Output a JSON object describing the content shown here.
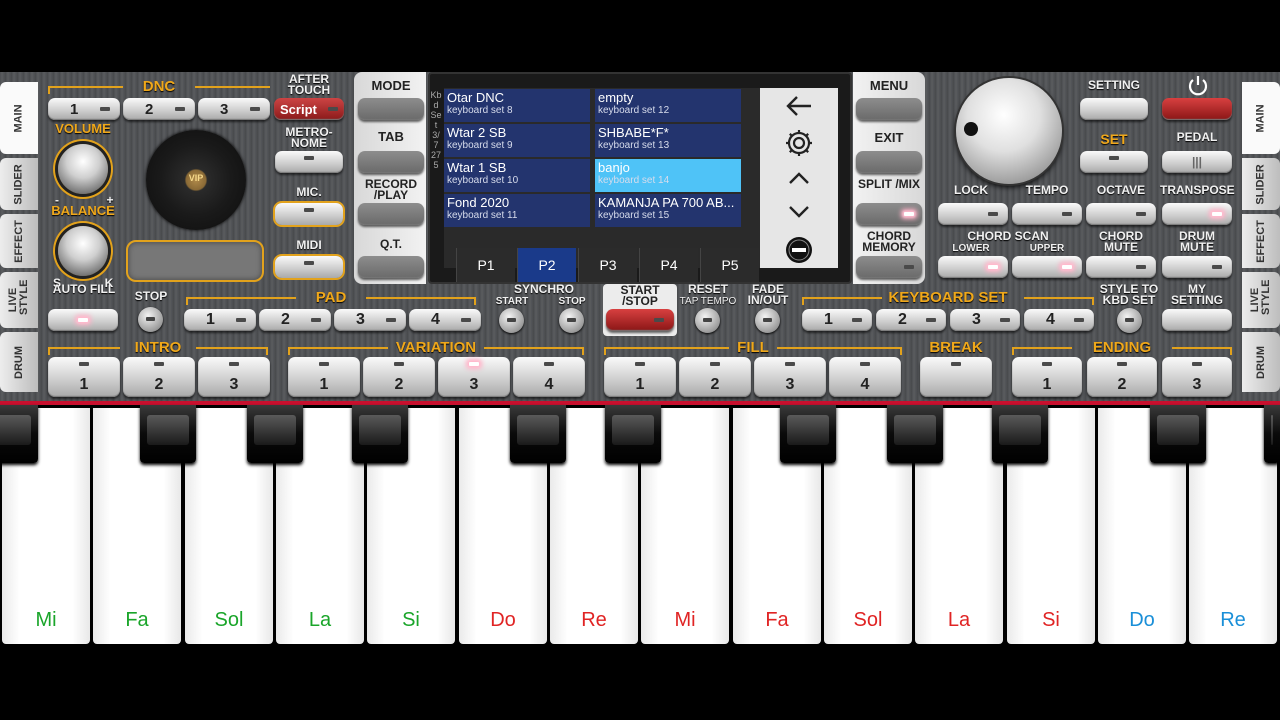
{
  "side_tabs_left": [
    "MAIN",
    "SLIDER",
    "EFFECT",
    "LIVE STYLE",
    "DRUM"
  ],
  "side_tabs_right": [
    "MAIN",
    "SLIDER",
    "EFFECT",
    "LIVE STYLE",
    "DRUM"
  ],
  "dnc": {
    "title": "DNC",
    "buttons": [
      "1",
      "2",
      "3"
    ],
    "script": "Script",
    "after_touch": "AFTER TOUCH"
  },
  "labels": {
    "volume": "VOLUME",
    "balance": "BALANCE",
    "s": "S",
    "k": "K",
    "minus": "-",
    "plus": "+",
    "metronome": "METRO- NOME",
    "mic": "MIC.",
    "midi": "MIDI",
    "vip": "VIP"
  },
  "center_left": {
    "mode": "MODE",
    "tab": "TAB",
    "record_play": "RECORD /PLAY",
    "qt": "Q.T."
  },
  "screen": {
    "side_letters": "Kbd Set 3/7 275",
    "cells": [
      {
        "name": "Otar DNC",
        "set": "keyboard set 8"
      },
      {
        "name": "empty",
        "set": "keyboard set 12"
      },
      {
        "name": "Wtar 2 SB",
        "set": "keyboard set 9"
      },
      {
        "name": "SHBABE*F*",
        "set": "keyboard set 13"
      },
      {
        "name": "Wtar 1 SB",
        "set": "keyboard set 10"
      },
      {
        "name": "banjo",
        "set": "keyboard set 14"
      },
      {
        "name": "Fond 2020",
        "set": "keyboard set 11"
      },
      {
        "name": "KAMANJA PA 700 AB...",
        "set": "keyboard set 15"
      }
    ],
    "selected_cell": 5,
    "pages": [
      "P1",
      "P2",
      "P3",
      "P4",
      "P5"
    ],
    "selected_page": 1,
    "icons": [
      "back-arrow-icon",
      "gear-icon",
      "chevron-up-icon",
      "chevron-down-icon",
      "minus-circle-icon"
    ]
  },
  "center_right": {
    "menu": "MENU",
    "exit": "EXIT",
    "split_mix": "SPLIT /MIX",
    "chord_memory": "CHORD MEMORY"
  },
  "right": {
    "setting": "SETTING",
    "set": "SET",
    "pedal": "PEDAL",
    "lock": "LOCK",
    "tempo": "TEMPO",
    "octave": "OCTAVE",
    "transpose": "TRANSPOSE",
    "chord_scan": "CHORD SCAN",
    "lower": "LOWER",
    "upper": "UPPER",
    "chord_mute": "CHORD MUTE",
    "drum_mute": "DRUM MUTE"
  },
  "row3": {
    "auto_fill": "AUTO FILL",
    "stop": "STOP",
    "pad": "PAD",
    "pad_buttons": [
      "1",
      "2",
      "3",
      "4"
    ],
    "synchro": "SYNCHRO",
    "start": "START",
    "stop2": "STOP",
    "start_stop": "START /STOP",
    "reset": "RESET",
    "tap_tempo": "TAP TEMPO",
    "fade": "FADE IN/OUT",
    "keyboard_set": "KEYBOARD SET",
    "kbd_buttons": [
      "1",
      "2",
      "3",
      "4"
    ],
    "style_to_kbd": "STYLE TO KBD SET",
    "my_setting": "MY SETTING"
  },
  "row4": {
    "intro": "INTRO",
    "intro_buttons": [
      "1",
      "2",
      "3"
    ],
    "variation": "VARIATION",
    "variation_buttons": [
      "1",
      "2",
      "3",
      "4"
    ],
    "fill": "FILL",
    "fill_buttons": [
      "1",
      "2",
      "3",
      "4"
    ],
    "break": "BREAK",
    "ending": "ENDING",
    "ending_buttons": [
      "1",
      "2",
      "3"
    ]
  },
  "keys": [
    {
      "note": "Mi",
      "color": "#1aa52a"
    },
    {
      "note": "Fa",
      "color": "#1aa52a"
    },
    {
      "note": "Sol",
      "color": "#1aa52a"
    },
    {
      "note": "La",
      "color": "#1aa52a"
    },
    {
      "note": "Si",
      "color": "#1aa52a"
    },
    {
      "note": "Do",
      "color": "#e02424"
    },
    {
      "note": "Re",
      "color": "#e02424"
    },
    {
      "note": "Mi",
      "color": "#e02424"
    },
    {
      "note": "Fa",
      "color": "#e02424"
    },
    {
      "note": "Sol",
      "color": "#e02424"
    },
    {
      "note": "La",
      "color": "#e02424"
    },
    {
      "note": "Si",
      "color": "#e02424"
    },
    {
      "note": "Do",
      "color": "#1a8fd8"
    },
    {
      "note": "Re",
      "color": "#1a8fd8"
    }
  ],
  "colors": {
    "accent": "#f0a81a",
    "selected_cell": "#4fc3f7",
    "cell": "#23346e",
    "redline": "#c8102e"
  }
}
